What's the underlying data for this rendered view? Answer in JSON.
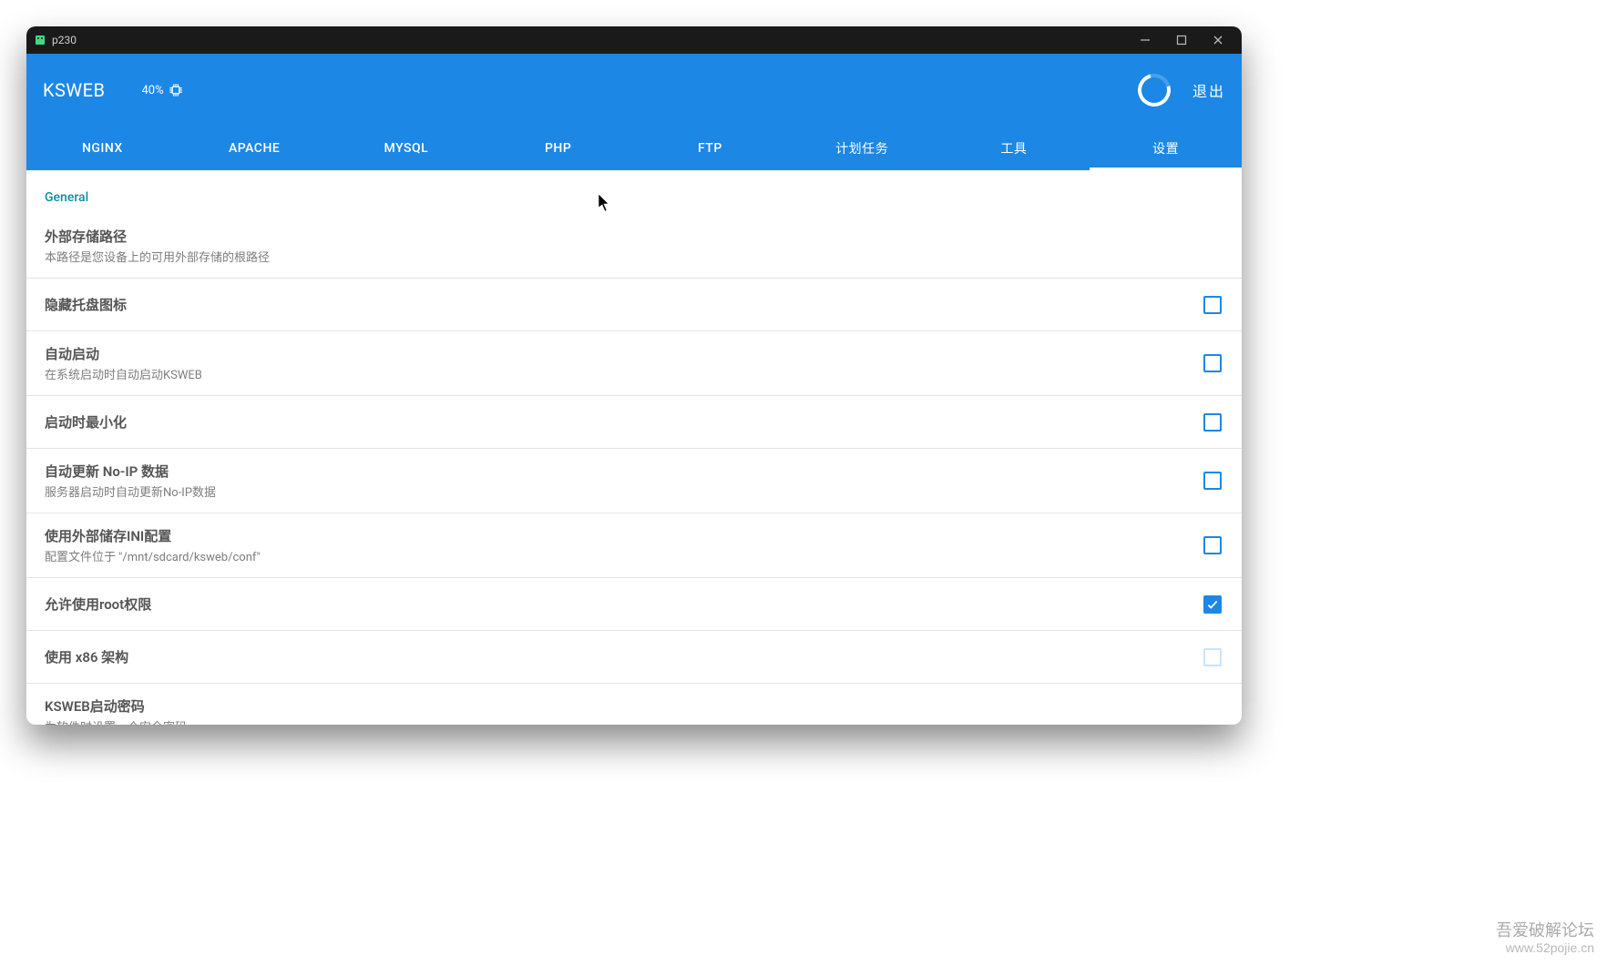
{
  "titlebar": {
    "text": "p230"
  },
  "header": {
    "app_name": "KSWEB",
    "cpu_percent": "40%",
    "exit_label": "退出"
  },
  "tabs": [
    {
      "id": "nginx",
      "label": "NGINX"
    },
    {
      "id": "apache",
      "label": "APACHE"
    },
    {
      "id": "mysql",
      "label": "MYSQL"
    },
    {
      "id": "php",
      "label": "PHP"
    },
    {
      "id": "ftp",
      "label": "FTP"
    },
    {
      "id": "scheduled",
      "label": "计划任务"
    },
    {
      "id": "tools",
      "label": "工具"
    },
    {
      "id": "settings",
      "label": "设置",
      "active": true
    }
  ],
  "section": {
    "general_label": "General"
  },
  "settings": [
    {
      "id": "ext-storage-path",
      "title": "外部存储路径",
      "sub": "本路径是您设备上的可用外部存储的根路径",
      "checkbox": null
    },
    {
      "id": "hide-tray-icon",
      "title": "隐藏托盘图标",
      "sub": null,
      "checkbox": {
        "checked": false,
        "disabled": false
      }
    },
    {
      "id": "auto-start",
      "title": "自动启动",
      "sub": "在系统启动时自动启动KSWEB",
      "checkbox": {
        "checked": false,
        "disabled": false
      }
    },
    {
      "id": "start-minimized",
      "title": "启动时最小化",
      "sub": null,
      "checkbox": {
        "checked": false,
        "disabled": false
      }
    },
    {
      "id": "auto-update-noip",
      "title": "自动更新 No-IP 数据",
      "sub": "服务器启动时自动更新No-IP数据",
      "checkbox": {
        "checked": false,
        "disabled": false
      }
    },
    {
      "id": "use-external-ini",
      "title": "使用外部储存INI配置",
      "sub": "配置文件位于 \"/mnt/sdcard/ksweb/conf\"",
      "checkbox": {
        "checked": false,
        "disabled": false
      }
    },
    {
      "id": "allow-root",
      "title": "允许使用root权限",
      "sub": null,
      "checkbox": {
        "checked": true,
        "disabled": false
      }
    },
    {
      "id": "use-x86",
      "title": "使用 x86 架构",
      "sub": null,
      "checkbox": {
        "checked": false,
        "disabled": true
      }
    },
    {
      "id": "start-password",
      "title": "KSWEB启动密码",
      "sub": "为软件时设置一个安全密码",
      "checkbox": null
    }
  ],
  "watermark": {
    "line1": "吾爱破解论坛",
    "line2": "www.52pojie.cn"
  }
}
